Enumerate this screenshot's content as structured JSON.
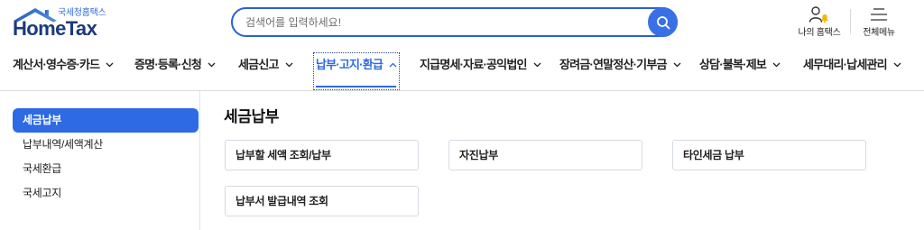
{
  "header": {
    "logo": {
      "subtitle": "국세청홈택스",
      "title": "HomeTax",
      "icon": "house-roof-logo-icon"
    },
    "search": {
      "placeholder": "검색어를 입력하세요!",
      "button_icon": "search-icon"
    },
    "my_hometax": {
      "label": "나의 홈택스",
      "icon": "user-bell-icon"
    },
    "all_menu": {
      "label": "전체메뉴",
      "icon": "hamburger-menu-icon"
    }
  },
  "nav": {
    "items": [
      {
        "label": "계산서·영수증·카드",
        "active": false,
        "expanded": false,
        "icon": "chevron-down-icon"
      },
      {
        "label": "증명·등록·신청",
        "active": false,
        "expanded": false,
        "icon": "chevron-down-icon"
      },
      {
        "label": "세금신고",
        "active": false,
        "expanded": false,
        "icon": "chevron-down-icon"
      },
      {
        "label": "납부·고지·환급",
        "active": true,
        "expanded": true,
        "icon": "chevron-up-icon"
      },
      {
        "label": "지급명세·자료·공익법인",
        "active": false,
        "expanded": false,
        "icon": "chevron-down-icon"
      },
      {
        "label": "장려금·연말정산·기부금",
        "active": false,
        "expanded": false,
        "icon": "chevron-down-icon"
      },
      {
        "label": "상담·불복·제보",
        "active": false,
        "expanded": false,
        "icon": "chevron-down-icon"
      },
      {
        "label": "세무대리·납세관리",
        "active": false,
        "expanded": false,
        "icon": "chevron-down-icon"
      }
    ]
  },
  "sidebar": {
    "items": [
      {
        "label": "세금납부",
        "active": true
      },
      {
        "label": "납부내역/세액계산",
        "active": false
      },
      {
        "label": "국세환급",
        "active": false
      },
      {
        "label": "국세고지",
        "active": false
      }
    ]
  },
  "main": {
    "title": "세금납부",
    "cards": [
      {
        "label": "납부할 세액 조회/납부"
      },
      {
        "label": "자진납부"
      },
      {
        "label": "타인세금 납부"
      },
      {
        "label": "납부서 발급내역 조회"
      }
    ]
  },
  "colors": {
    "accent": "#2d6ae3",
    "logo_navy": "#1b3a7a",
    "search_border": "#2a5fd6",
    "search_button": "#3a70e6",
    "bell": "#f5b400"
  }
}
